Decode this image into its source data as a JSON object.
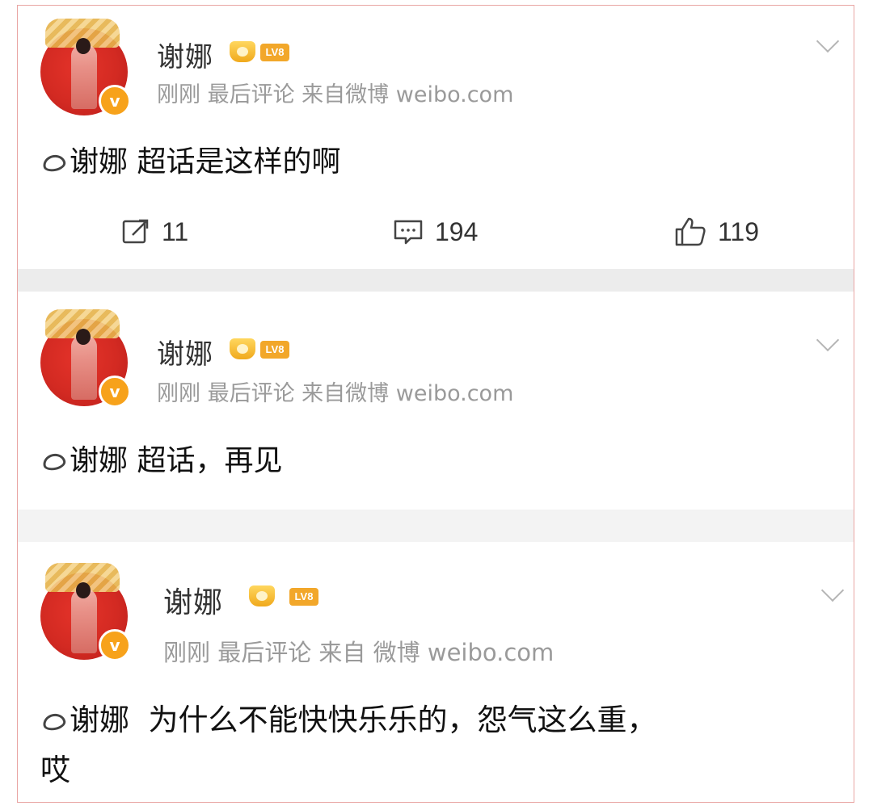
{
  "posts": [
    {
      "username": "谢娜",
      "level_badge": "LV8",
      "meta": "刚刚 最后评论 来自微博 weibo.com",
      "topic": "谢娜",
      "text": "超话是这样的啊",
      "actions": {
        "share": "11",
        "comment": "194",
        "like": "119"
      }
    },
    {
      "username": "谢娜",
      "level_badge": "LV8",
      "meta": "刚刚 最后评论 来自微博 weibo.com",
      "topic": "谢娜",
      "text": "超话，再见"
    },
    {
      "username": "谢娜",
      "level_badge": "LV8",
      "meta": "刚刚 最后评论 来自 微博 weibo.com",
      "topic": "谢娜",
      "text_line1": "为什么不能快快乐乐的，怨气这么重，",
      "text_line2": "哎"
    }
  ],
  "icons": {
    "avatar_badge": "v-verified-icon",
    "crown": "crown-icon",
    "topic": "supertopic-diamond-icon",
    "share": "share-icon",
    "comment": "comment-icon",
    "like": "thumbs-up-icon",
    "more": "chevron-down-icon"
  },
  "colors": {
    "border": "#e9a5a3",
    "badge": "#f2a72a",
    "avatar_red": "#d32a22",
    "meta_gray": "#9a9a9a"
  }
}
